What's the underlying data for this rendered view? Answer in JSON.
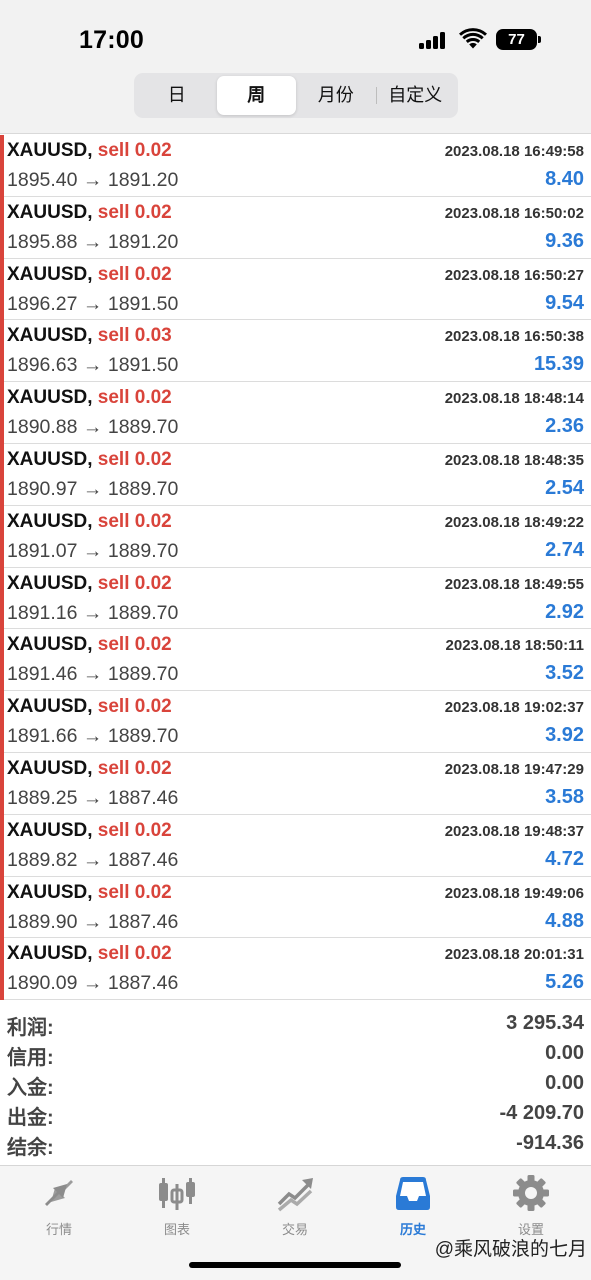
{
  "status_bar": {
    "time": "17:00",
    "battery": "77"
  },
  "segments": [
    {
      "label": "日",
      "active": false
    },
    {
      "label": "周",
      "active": true
    },
    {
      "label": "月份",
      "active": false
    },
    {
      "label": "自定义",
      "active": false
    }
  ],
  "trades": [
    {
      "symbol": "XAUUSD,",
      "side": "sell 0.02",
      "time": "2023.08.18 16:49:58",
      "open": "1895.40",
      "close": "1891.20",
      "profit": "8.40"
    },
    {
      "symbol": "XAUUSD,",
      "side": "sell 0.02",
      "time": "2023.08.18 16:50:02",
      "open": "1895.88",
      "close": "1891.20",
      "profit": "9.36"
    },
    {
      "symbol": "XAUUSD,",
      "side": "sell 0.02",
      "time": "2023.08.18 16:50:27",
      "open": "1896.27",
      "close": "1891.50",
      "profit": "9.54"
    },
    {
      "symbol": "XAUUSD,",
      "side": "sell 0.03",
      "time": "2023.08.18 16:50:38",
      "open": "1896.63",
      "close": "1891.50",
      "profit": "15.39"
    },
    {
      "symbol": "XAUUSD,",
      "side": "sell 0.02",
      "time": "2023.08.18 18:48:14",
      "open": "1890.88",
      "close": "1889.70",
      "profit": "2.36"
    },
    {
      "symbol": "XAUUSD,",
      "side": "sell 0.02",
      "time": "2023.08.18 18:48:35",
      "open": "1890.97",
      "close": "1889.70",
      "profit": "2.54"
    },
    {
      "symbol": "XAUUSD,",
      "side": "sell 0.02",
      "time": "2023.08.18 18:49:22",
      "open": "1891.07",
      "close": "1889.70",
      "profit": "2.74"
    },
    {
      "symbol": "XAUUSD,",
      "side": "sell 0.02",
      "time": "2023.08.18 18:49:55",
      "open": "1891.16",
      "close": "1889.70",
      "profit": "2.92"
    },
    {
      "symbol": "XAUUSD,",
      "side": "sell 0.02",
      "time": "2023.08.18 18:50:11",
      "open": "1891.46",
      "close": "1889.70",
      "profit": "3.52"
    },
    {
      "symbol": "XAUUSD,",
      "side": "sell 0.02",
      "time": "2023.08.18 19:02:37",
      "open": "1891.66",
      "close": "1889.70",
      "profit": "3.92"
    },
    {
      "symbol": "XAUUSD,",
      "side": "sell 0.02",
      "time": "2023.08.18 19:47:29",
      "open": "1889.25",
      "close": "1887.46",
      "profit": "3.58"
    },
    {
      "symbol": "XAUUSD,",
      "side": "sell 0.02",
      "time": "2023.08.18 19:48:37",
      "open": "1889.82",
      "close": "1887.46",
      "profit": "4.72"
    },
    {
      "symbol": "XAUUSD,",
      "side": "sell 0.02",
      "time": "2023.08.18 19:49:06",
      "open": "1889.90",
      "close": "1887.46",
      "profit": "4.88"
    },
    {
      "symbol": "XAUUSD,",
      "side": "sell 0.02",
      "time": "2023.08.18 20:01:31",
      "open": "1890.09",
      "close": "1887.46",
      "profit": "5.26"
    }
  ],
  "summary": [
    {
      "label": "利润:",
      "value": "3 295.34"
    },
    {
      "label": "信用:",
      "value": "0.00"
    },
    {
      "label": "入金:",
      "value": "0.00"
    },
    {
      "label": "出金:",
      "value": "-4 209.70"
    },
    {
      "label": "结余:",
      "value": "-914.36"
    }
  ],
  "tabs": [
    {
      "label": "行情",
      "icon": "quotes-icon",
      "active": false
    },
    {
      "label": "图表",
      "icon": "chart-icon",
      "active": false
    },
    {
      "label": "交易",
      "icon": "trade-icon",
      "active": false
    },
    {
      "label": "历史",
      "icon": "history-icon",
      "active": true
    },
    {
      "label": "设置",
      "icon": "settings-icon",
      "active": false
    }
  ],
  "watermark": "@乘风破浪的七月",
  "colors": {
    "sell": "#d9443b",
    "profit": "#2a7ad6",
    "active_tab": "#2a7ad6",
    "inactive_tab": "#8c8c8c"
  }
}
